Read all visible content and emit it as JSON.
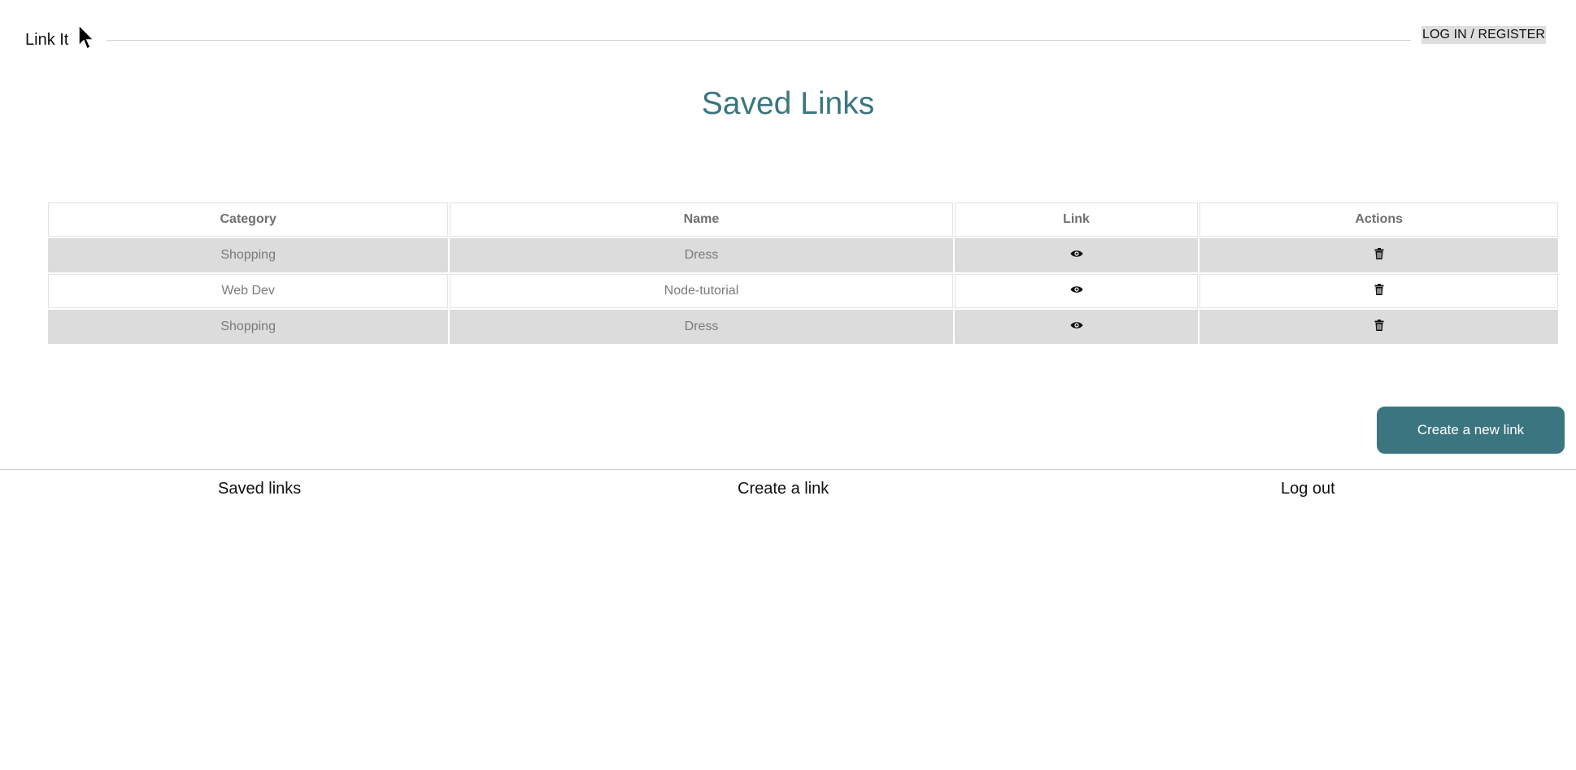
{
  "header": {
    "brand": "Link It",
    "login_label": "LOG IN / REGISTER"
  },
  "page_title": "Saved Links",
  "table": {
    "headers": [
      "Category",
      "Name",
      "Link",
      "Actions"
    ],
    "rows": [
      {
        "category": "Shopping",
        "name": "Dress",
        "link_icon": "eye-icon",
        "action_icon": "trash-icon"
      },
      {
        "category": "Web Dev",
        "name": "Node-tutorial",
        "link_icon": "eye-icon",
        "action_icon": "trash-icon"
      },
      {
        "category": "Shopping",
        "name": "Dress",
        "link_icon": "eye-icon",
        "action_icon": "trash-icon"
      }
    ]
  },
  "create_button_label": "Create a new link",
  "footer": {
    "links": [
      "Saved links",
      "Create a link",
      "Log out"
    ]
  },
  "colors": {
    "accent": "#3b7680",
    "row_shade": "#dcdcdc",
    "text_muted": "#7a7a7a"
  }
}
